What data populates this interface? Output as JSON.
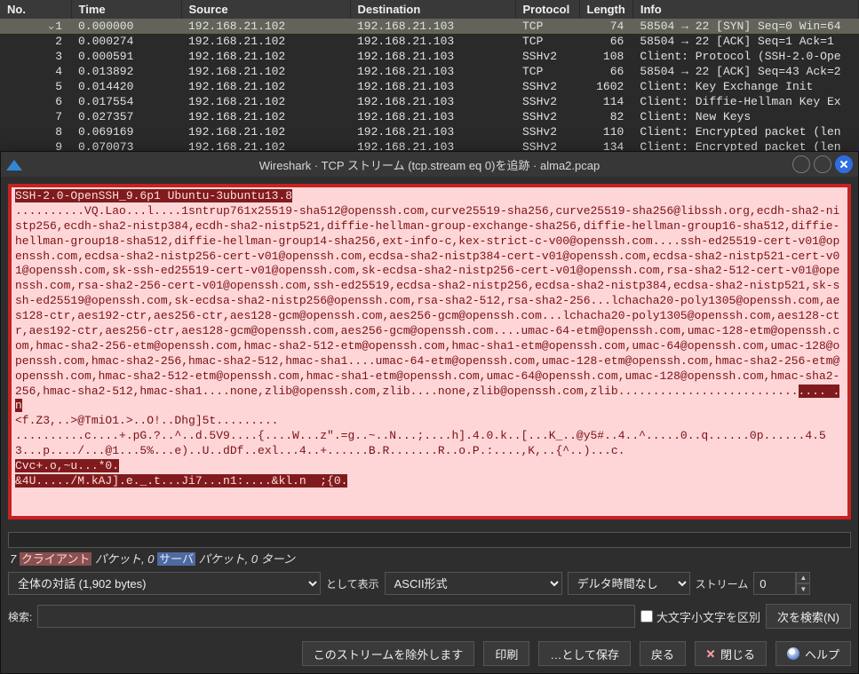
{
  "columns": {
    "no": "No.",
    "time": "Time",
    "source": "Source",
    "destination": "Destination",
    "protocol": "Protocol",
    "length": "Length",
    "info": "Info"
  },
  "packets": [
    {
      "no": "1",
      "time": "0.000000",
      "src": "192.168.21.102",
      "dst": "192.168.21.103",
      "proto": "TCP",
      "len": "74",
      "info": "58504 → 22 [SYN] Seq=0 Win=64",
      "hl": true
    },
    {
      "no": "2",
      "time": "0.000274",
      "src": "192.168.21.102",
      "dst": "192.168.21.103",
      "proto": "TCP",
      "len": "66",
      "info": "58504 → 22 [ACK] Seq=1 Ack=1"
    },
    {
      "no": "3",
      "time": "0.000591",
      "src": "192.168.21.102",
      "dst": "192.168.21.103",
      "proto": "SSHv2",
      "len": "108",
      "info": "Client: Protocol (SSH-2.0-Ope"
    },
    {
      "no": "4",
      "time": "0.013892",
      "src": "192.168.21.102",
      "dst": "192.168.21.103",
      "proto": "TCP",
      "len": "66",
      "info": "58504 → 22 [ACK] Seq=43 Ack=2"
    },
    {
      "no": "5",
      "time": "0.014420",
      "src": "192.168.21.102",
      "dst": "192.168.21.103",
      "proto": "SSHv2",
      "len": "1602",
      "info": "Client: Key Exchange Init"
    },
    {
      "no": "6",
      "time": "0.017554",
      "src": "192.168.21.102",
      "dst": "192.168.21.103",
      "proto": "SSHv2",
      "len": "114",
      "info": "Client: Diffie-Hellman Key Ex"
    },
    {
      "no": "7",
      "time": "0.027357",
      "src": "192.168.21.102",
      "dst": "192.168.21.103",
      "proto": "SSHv2",
      "len": "82",
      "info": "Client: New Keys"
    },
    {
      "no": "8",
      "time": "0.069169",
      "src": "192.168.21.102",
      "dst": "192.168.21.103",
      "proto": "SSHv2",
      "len": "110",
      "info": "Client: Encrypted packet (len"
    },
    {
      "no": "9",
      "time": "0.070073",
      "src": "192.168.21.102",
      "dst": "192.168.21.103",
      "proto": "SSHv2",
      "len": "134",
      "info": "Client: Encrypted packet (len"
    }
  ],
  "dialog": {
    "title": "Wireshark · TCP ストリーム (tcp.stream eq 0)を追跡 · alma2.pcap"
  },
  "stream": {
    "line1": "SSH-2.0-OpenSSH_9.6p1 Ubuntu-3ubuntu13.8",
    "body_a": "..........VQ.Lao...l....1sntrup761x25519-sha512@openssh.com,curve25519-sha256,curve25519-sha256@libssh.org,ecdh-sha2-nistp256,ecdh-sha2-nistp384,ecdh-sha2-nistp521,diffie-hellman-group-exchange-sha256,diffie-hellman-group16-sha512,diffie-hellman-group18-sha512,diffie-hellman-group14-sha256,ext-info-c,kex-strict-c-v00@openssh.com....ssh-ed25519-cert-v01@openssh.com,ecdsa-sha2-nistp256-cert-v01@openssh.com,ecdsa-sha2-nistp384-cert-v01@openssh.com,ecdsa-sha2-nistp521-cert-v01@openssh.com,sk-ssh-ed25519-cert-v01@openssh.com,sk-ecdsa-sha2-nistp256-cert-v01@openssh.com,rsa-sha2-512-cert-v01@openssh.com,rsa-sha2-256-cert-v01@openssh.com,ssh-ed25519,ecdsa-sha2-nistp256,ecdsa-sha2-nistp384,ecdsa-sha2-nistp521,sk-ssh-ed25519@openssh.com,sk-ecdsa-sha2-nistp256@openssh.com,rsa-sha2-512,rsa-sha2-256...lchacha20-poly1305@openssh.com,aes128-ctr,aes192-ctr,aes256-ctr,aes128-gcm@openssh.com,aes256-gcm@openssh.com...lchacha20-poly1305@openssh.com,aes128-ctr,aes192-ctr,aes256-ctr,aes128-gcm@openssh.com,aes256-gcm@openssh.com....umac-64-etm@openssh.com,umac-128-etm@openssh.com,hmac-sha2-256-etm@openssh.com,hmac-sha2-512-etm@openssh.com,hmac-sha1-etm@openssh.com,umac-64@openssh.com,umac-128@openssh.com,hmac-sha2-256,hmac-sha2-512,hmac-sha1....umac-64-etm@openssh.com,umac-128-etm@openssh.com,hmac-sha2-256-etm@openssh.com,hmac-sha2-512-etm@openssh.com,hmac-sha1-etm@openssh.com,umac-64@openssh.com,umac-128@openssh.com,hmac-sha2-256,hmac-sha2-512,hmac-sha1....none,zlib@openssh.com,zlib....none,zlib@openssh.com,zlib..........................",
    "gap1": ".... .n",
    "body_b": "<f.Z3,..>@TmiO1.>..O!..Dhg]5t.........",
    "body_c": "..........c....+.pG.?..^..d.5V9....{....W...z\".=g..~..N...;....h].4.0.k..[...K_..@y5#..4..^.....0..q......0p......4.53...p..../...@1...5%...e)..U..dDf..exl...4..+......B.R.......R..o.P.:....,K,..{^..)...c.",
    "body_d": "Cvc+.o,~u...*0.",
    "body_e": "&4U...../M.kAJ].e._.t...Ji7...n1:....&kl.n  ;{0."
  },
  "stats": {
    "count": "7",
    "client_label": "クライアント",
    "pkt_word": "パケット",
    "s_count": "0",
    "server_label": "サーバ",
    "turns": "0 ターン"
  },
  "controls": {
    "conversation": "全体の対話 (1,902 bytes)",
    "show_as_label": "として表示",
    "show_as_value": "ASCII形式",
    "delta": "デルタ時間なし",
    "stream_label": "ストリーム",
    "stream_value": "0",
    "search_label": "検索:",
    "case_label": "大文字小文字を区別",
    "find_next": "次を検索(N)",
    "find_next_u": "N"
  },
  "buttons": {
    "filter_out": "このストリームを除外します",
    "print": "印刷",
    "save_as": "…として保存",
    "back": "戻る",
    "close": "閉じる",
    "help": "ヘルプ"
  }
}
